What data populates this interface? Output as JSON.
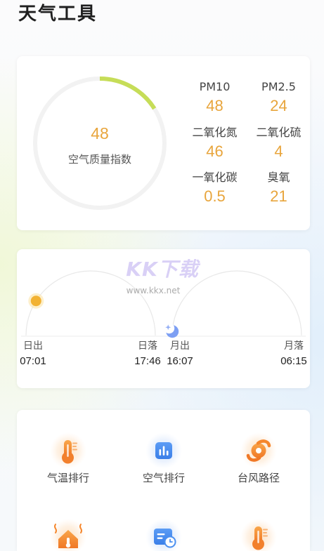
{
  "app": {
    "title": "天气工具"
  },
  "air_quality": {
    "aqi": "48",
    "aqi_label": "空气质量指数",
    "gauge_fill": 0.16,
    "gauge_color": "#c6dd58",
    "value_color": "#e8a53c",
    "pollutants": [
      {
        "label": "PM10",
        "value": "48"
      },
      {
        "label": "PM2.5",
        "value": "24"
      },
      {
        "label": "二氧化氮",
        "value": "46"
      },
      {
        "label": "二氧化硫",
        "value": "4"
      },
      {
        "label": "一氧化碳",
        "value": "0.5"
      },
      {
        "label": "臭氧",
        "value": "21"
      }
    ]
  },
  "sun_moon": {
    "sunrise_label": "日出",
    "sunrise": "07:01",
    "sunset_label": "日落",
    "sunset": "17:46",
    "moonrise_label": "月出",
    "moonrise": "16:07",
    "moonset_label": "月落",
    "moonset": "06:15",
    "sun_progress": 0.18,
    "moon_progress": 0.02,
    "sun_color": "#f2b233",
    "moon_color": "#7d9ff3"
  },
  "tools": [
    {
      "label": "气温排行",
      "icon": "thermometer-icon"
    },
    {
      "label": "空气排行",
      "icon": "air-chart-icon"
    },
    {
      "label": "台风路径",
      "icon": "typhoon-icon"
    },
    {
      "icon": "house-heat-icon"
    },
    {
      "icon": "calendar-clock-icon"
    },
    {
      "icon": "thermometer-icon"
    }
  ],
  "watermark": {
    "logo": "KK下载",
    "url": "www.kkx.net"
  }
}
